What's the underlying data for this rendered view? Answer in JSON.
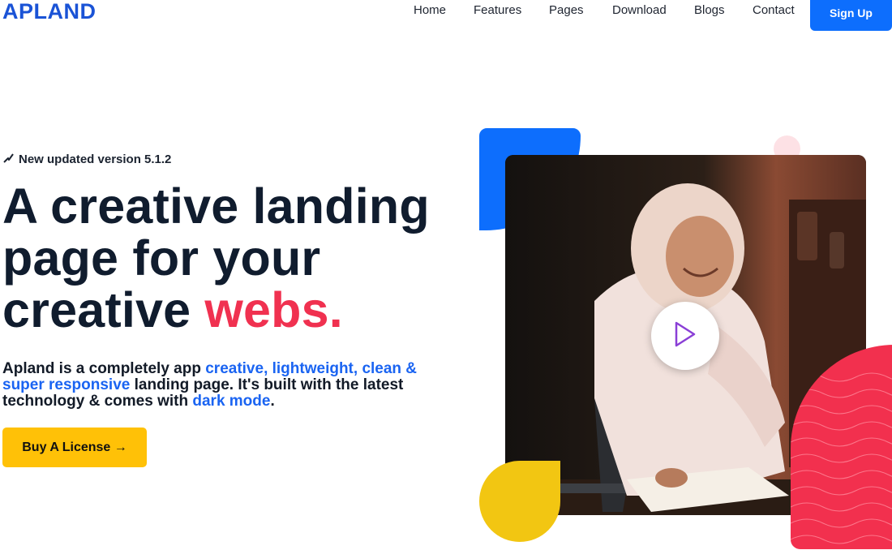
{
  "header": {
    "logo": "APLAND",
    "nav": [
      {
        "label": "Home"
      },
      {
        "label": "Features"
      },
      {
        "label": "Pages"
      },
      {
        "label": "Download"
      },
      {
        "label": "Blogs"
      },
      {
        "label": "Contact"
      }
    ],
    "signup_label": "Sign Up"
  },
  "hero": {
    "badge": "New updated version 5.1.2",
    "headline": {
      "line1": "A creative landing",
      "line2": "page for your",
      "line3_plain": "creative ",
      "line3_accent": "webs."
    },
    "desc": {
      "p1": "Apland is a completely app ",
      "hl1": "creative, lightweight, clean & super responsive",
      "p2": " landing page. It's built with the latest technology & comes with ",
      "hl2": "dark mode",
      "p3": "."
    },
    "cta_label": "Buy A License →"
  },
  "colors": {
    "brand_blue": "#0d6efd",
    "accent_red": "#f03150",
    "accent_yellow": "#ffc107",
    "text_dark": "#101c2e"
  },
  "icons": {
    "badge_icon": "lightning-icon",
    "play_icon": "play-icon"
  }
}
